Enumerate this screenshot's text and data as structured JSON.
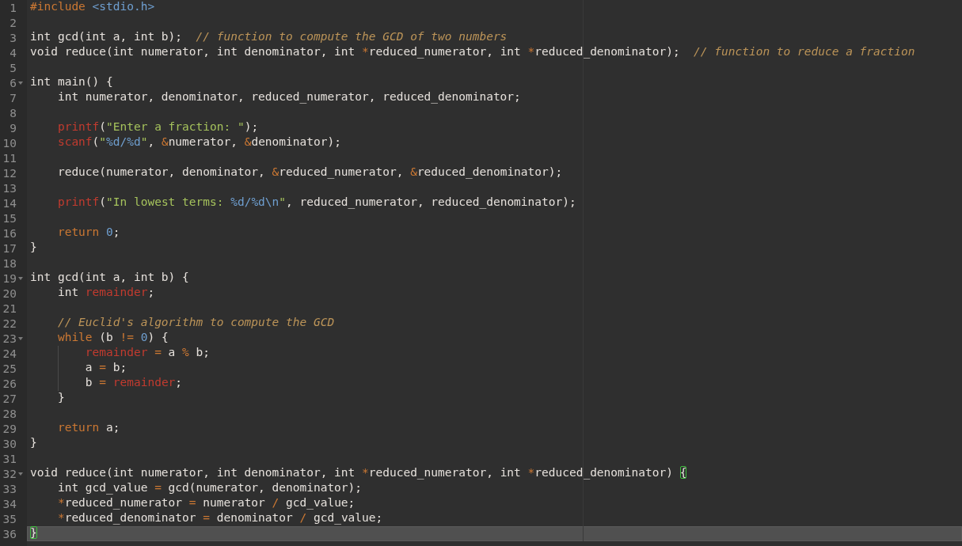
{
  "editor": {
    "lines": [
      {
        "number": "1",
        "foldable": false,
        "active": false,
        "tokens": [
          {
            "text": "#include ",
            "kind": "preproc"
          },
          {
            "text": "<stdio.h>",
            "kind": "include"
          }
        ]
      },
      {
        "number": "2",
        "foldable": false,
        "active": false
      },
      {
        "number": "3",
        "foldable": false,
        "active": false,
        "tokens": [
          {
            "text": "int gcd(int a, int b);  ",
            "kind": "plain"
          },
          {
            "text": "// function to compute the GCD of two numbers",
            "kind": "comment"
          }
        ]
      },
      {
        "number": "4",
        "foldable": false,
        "active": false,
        "tokens": [
          {
            "text": "void reduce(int numerator, int denominator, int ",
            "kind": "plain"
          },
          {
            "text": "*",
            "kind": "operator"
          },
          {
            "text": "reduced_numerator, int ",
            "kind": "plain"
          },
          {
            "text": "*",
            "kind": "operator"
          },
          {
            "text": "reduced_denominator);  ",
            "kind": "plain"
          },
          {
            "text": "// function to reduce a fraction",
            "kind": "comment"
          }
        ]
      },
      {
        "number": "5",
        "foldable": false,
        "active": false
      },
      {
        "number": "6",
        "foldable": true,
        "active": false,
        "tokens": [
          {
            "text": "int main() {",
            "kind": "plain"
          }
        ]
      },
      {
        "number": "7",
        "foldable": false,
        "active": false,
        "tokens": [
          {
            "text": "    int numerator, denominator, reduced_numerator, reduced_denominator;",
            "kind": "plain"
          }
        ]
      },
      {
        "number": "8",
        "foldable": false,
        "active": false
      },
      {
        "number": "9",
        "foldable": false,
        "active": false,
        "tokens": [
          {
            "text": "    printf",
            "kind": "builtin"
          },
          {
            "text": "(",
            "kind": "plain"
          },
          {
            "text": "\"Enter a fraction: \"",
            "kind": "string"
          },
          {
            "text": ");",
            "kind": "plain"
          }
        ]
      },
      {
        "number": "10",
        "foldable": false,
        "active": false,
        "tokens": [
          {
            "text": "    scanf",
            "kind": "builtin"
          },
          {
            "text": "(",
            "kind": "plain"
          },
          {
            "text": "\"",
            "kind": "string"
          },
          {
            "text": "%d/%d",
            "kind": "format"
          },
          {
            "text": "\"",
            "kind": "string"
          },
          {
            "text": ", ",
            "kind": "plain"
          },
          {
            "text": "&",
            "kind": "operator"
          },
          {
            "text": "numerator, ",
            "kind": "plain"
          },
          {
            "text": "&",
            "kind": "operator"
          },
          {
            "text": "denominator);",
            "kind": "plain"
          }
        ]
      },
      {
        "number": "11",
        "foldable": false,
        "active": false
      },
      {
        "number": "12",
        "foldable": false,
        "active": false,
        "tokens": [
          {
            "text": "    reduce(numerator, denominator, ",
            "kind": "plain"
          },
          {
            "text": "&",
            "kind": "operator"
          },
          {
            "text": "reduced_numerator, ",
            "kind": "plain"
          },
          {
            "text": "&",
            "kind": "operator"
          },
          {
            "text": "reduced_denominator);",
            "kind": "plain"
          }
        ]
      },
      {
        "number": "13",
        "foldable": false,
        "active": false
      },
      {
        "number": "14",
        "foldable": false,
        "active": false,
        "tokens": [
          {
            "text": "    printf",
            "kind": "builtin"
          },
          {
            "text": "(",
            "kind": "plain"
          },
          {
            "text": "\"In lowest terms: ",
            "kind": "string"
          },
          {
            "text": "%d/%d\\n",
            "kind": "format"
          },
          {
            "text": "\"",
            "kind": "string"
          },
          {
            "text": ", reduced_numerator, reduced_denominator);",
            "kind": "plain"
          }
        ]
      },
      {
        "number": "15",
        "foldable": false,
        "active": false
      },
      {
        "number": "16",
        "foldable": false,
        "active": false,
        "tokens": [
          {
            "text": "    return ",
            "kind": "keyword"
          },
          {
            "text": "0",
            "kind": "number"
          },
          {
            "text": ";",
            "kind": "plain"
          }
        ]
      },
      {
        "number": "17",
        "foldable": false,
        "active": false,
        "tokens": [
          {
            "text": "}",
            "kind": "plain"
          }
        ]
      },
      {
        "number": "18",
        "foldable": false,
        "active": false
      },
      {
        "number": "19",
        "foldable": true,
        "active": false,
        "tokens": [
          {
            "text": "int gcd(int a, int b) {",
            "kind": "plain"
          }
        ]
      },
      {
        "number": "20",
        "foldable": false,
        "active": false,
        "tokens": [
          {
            "text": "    int ",
            "kind": "plain"
          },
          {
            "text": "remainder",
            "kind": "builtin"
          },
          {
            "text": ";",
            "kind": "plain"
          }
        ]
      },
      {
        "number": "21",
        "foldable": false,
        "active": false
      },
      {
        "number": "22",
        "foldable": false,
        "active": false,
        "tokens": [
          {
            "text": "    // Euclid's algorithm to compute the GCD",
            "kind": "comment"
          }
        ]
      },
      {
        "number": "23",
        "foldable": true,
        "active": false,
        "tokens": [
          {
            "text": "    while",
            "kind": "keyword"
          },
          {
            "text": " (b ",
            "kind": "plain"
          },
          {
            "text": "!= ",
            "kind": "operator"
          },
          {
            "text": "0",
            "kind": "number"
          },
          {
            "text": ") {",
            "kind": "plain"
          }
        ]
      },
      {
        "number": "24",
        "foldable": false,
        "active": false,
        "tokens": [
          {
            "text": "        remainder ",
            "kind": "builtin"
          },
          {
            "text": "=",
            "kind": "operator"
          },
          {
            "text": " a ",
            "kind": "plain"
          },
          {
            "text": "%",
            "kind": "operator"
          },
          {
            "text": " b;",
            "kind": "plain"
          }
        ]
      },
      {
        "number": "25",
        "foldable": false,
        "active": false,
        "tokens": [
          {
            "text": "        a ",
            "kind": "plain"
          },
          {
            "text": "=",
            "kind": "operator"
          },
          {
            "text": " b;",
            "kind": "plain"
          }
        ]
      },
      {
        "number": "26",
        "foldable": false,
        "active": false,
        "tokens": [
          {
            "text": "        b ",
            "kind": "plain"
          },
          {
            "text": "= ",
            "kind": "operator"
          },
          {
            "text": "remainder",
            "kind": "builtin"
          },
          {
            "text": ";",
            "kind": "plain"
          }
        ]
      },
      {
        "number": "27",
        "foldable": false,
        "active": false,
        "tokens": [
          {
            "text": "    }",
            "kind": "plain"
          }
        ]
      },
      {
        "number": "28",
        "foldable": false,
        "active": false
      },
      {
        "number": "29",
        "foldable": false,
        "active": false,
        "tokens": [
          {
            "text": "    return",
            "kind": "keyword"
          },
          {
            "text": " a;",
            "kind": "plain"
          }
        ]
      },
      {
        "number": "30",
        "foldable": false,
        "active": false,
        "tokens": [
          {
            "text": "}",
            "kind": "plain"
          }
        ]
      },
      {
        "number": "31",
        "foldable": false,
        "active": false
      },
      {
        "number": "32",
        "foldable": true,
        "active": false,
        "tokens": [
          {
            "text": "void reduce(int numerator, int denominator, int ",
            "kind": "plain"
          },
          {
            "text": "*",
            "kind": "operator"
          },
          {
            "text": "reduced_numerator, int ",
            "kind": "plain"
          },
          {
            "text": "*",
            "kind": "operator"
          },
          {
            "text": "reduced_denominator) ",
            "kind": "plain"
          },
          {
            "text": "{",
            "kind": "bracket_match"
          }
        ]
      },
      {
        "number": "33",
        "foldable": false,
        "active": false,
        "tokens": [
          {
            "text": "    int gcd_value ",
            "kind": "plain"
          },
          {
            "text": "=",
            "kind": "operator"
          },
          {
            "text": " gcd(numerator, denominator);",
            "kind": "plain"
          }
        ]
      },
      {
        "number": "34",
        "foldable": false,
        "active": false,
        "tokens": [
          {
            "text": "    *",
            "kind": "operator"
          },
          {
            "text": "reduced_numerator ",
            "kind": "plain"
          },
          {
            "text": "=",
            "kind": "operator"
          },
          {
            "text": " numerator ",
            "kind": "plain"
          },
          {
            "text": "/",
            "kind": "operator"
          },
          {
            "text": " gcd_value;",
            "kind": "plain"
          }
        ]
      },
      {
        "number": "35",
        "foldable": false,
        "active": false,
        "tokens": [
          {
            "text": "    *",
            "kind": "operator"
          },
          {
            "text": "reduced_denominator ",
            "kind": "plain"
          },
          {
            "text": "=",
            "kind": "operator"
          },
          {
            "text": " denominator ",
            "kind": "plain"
          },
          {
            "text": "/",
            "kind": "operator"
          },
          {
            "text": " gcd_value;",
            "kind": "plain"
          }
        ]
      },
      {
        "number": "36",
        "foldable": false,
        "active": true,
        "tokens": [
          {
            "text": "}",
            "kind": "bracket_match"
          }
        ]
      }
    ]
  }
}
